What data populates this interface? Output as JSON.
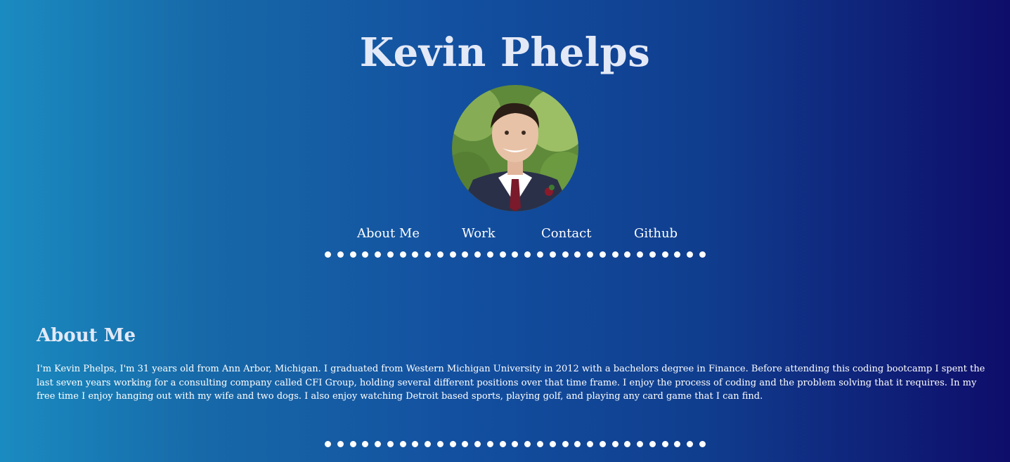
{
  "header": {
    "title": "Kevin Phelps"
  },
  "nav": {
    "items": [
      {
        "label": "About Me"
      },
      {
        "label": "Work"
      },
      {
        "label": "Contact"
      },
      {
        "label": "Github"
      }
    ]
  },
  "about": {
    "title": "About Me",
    "text": "I'm Kevin Phelps, I'm 31 years old from Ann Arbor, Michigan. I graduated from Western Michigan University in 2012 with a bachelors degree in Finance. Before attending this coding bootcamp I spent the last seven years working for a consulting company called CFI Group, holding several different positions over that time frame. I enjoy the process of coding and the problem solving that it requires. In my free time I enjoy hanging out with my wife and two dogs. I also enjoy watching Detroit based sports, playing golf, and playing any card game that I can find."
  },
  "colors": {
    "gradient_start": "#1a8bc0",
    "gradient_end": "#0e0d6a",
    "title_text": "#e3e9f7",
    "body_text": "#ffffff"
  }
}
